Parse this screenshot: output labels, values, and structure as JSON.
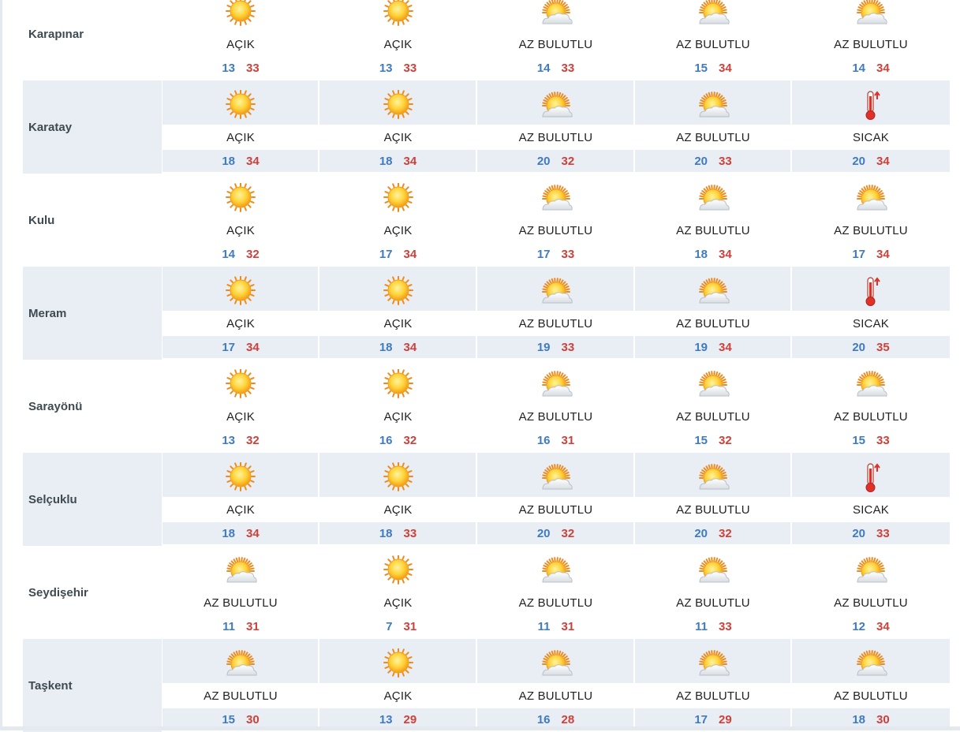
{
  "icons": {
    "sunny": "sun-icon",
    "partly": "sun-cloud-icon",
    "hot": "thermometer-icon"
  },
  "colors": {
    "min": "#3f7bbf",
    "max": "#d0403a",
    "shade": "#e8eef3"
  },
  "rows": [
    {
      "name": "Karapınar",
      "days": [
        {
          "cond": "AÇIK",
          "icon": "sunny",
          "min": "13",
          "max": "33"
        },
        {
          "cond": "AÇIK",
          "icon": "sunny",
          "min": "13",
          "max": "33"
        },
        {
          "cond": "AZ BULUTLU",
          "icon": "partly",
          "min": "14",
          "max": "33"
        },
        {
          "cond": "AZ BULUTLU",
          "icon": "partly",
          "min": "15",
          "max": "34"
        },
        {
          "cond": "AZ BULUTLU",
          "icon": "partly",
          "min": "14",
          "max": "34"
        }
      ]
    },
    {
      "name": "Karatay",
      "days": [
        {
          "cond": "AÇIK",
          "icon": "sunny",
          "min": "18",
          "max": "34"
        },
        {
          "cond": "AÇIK",
          "icon": "sunny",
          "min": "18",
          "max": "34"
        },
        {
          "cond": "AZ BULUTLU",
          "icon": "partly",
          "min": "20",
          "max": "32"
        },
        {
          "cond": "AZ BULUTLU",
          "icon": "partly",
          "min": "20",
          "max": "33"
        },
        {
          "cond": "SICAK",
          "icon": "hot",
          "min": "20",
          "max": "34"
        }
      ]
    },
    {
      "name": "Kulu",
      "days": [
        {
          "cond": "AÇIK",
          "icon": "sunny",
          "min": "14",
          "max": "32"
        },
        {
          "cond": "AÇIK",
          "icon": "sunny",
          "min": "17",
          "max": "34"
        },
        {
          "cond": "AZ BULUTLU",
          "icon": "partly",
          "min": "17",
          "max": "33"
        },
        {
          "cond": "AZ BULUTLU",
          "icon": "partly",
          "min": "18",
          "max": "34"
        },
        {
          "cond": "AZ BULUTLU",
          "icon": "partly",
          "min": "17",
          "max": "34"
        }
      ]
    },
    {
      "name": "Meram",
      "days": [
        {
          "cond": "AÇIK",
          "icon": "sunny",
          "min": "17",
          "max": "34"
        },
        {
          "cond": "AÇIK",
          "icon": "sunny",
          "min": "18",
          "max": "34"
        },
        {
          "cond": "AZ BULUTLU",
          "icon": "partly",
          "min": "19",
          "max": "33"
        },
        {
          "cond": "AZ BULUTLU",
          "icon": "partly",
          "min": "19",
          "max": "34"
        },
        {
          "cond": "SICAK",
          "icon": "hot",
          "min": "20",
          "max": "35"
        }
      ]
    },
    {
      "name": "Sarayönü",
      "days": [
        {
          "cond": "AÇIK",
          "icon": "sunny",
          "min": "13",
          "max": "32"
        },
        {
          "cond": "AÇIK",
          "icon": "sunny",
          "min": "16",
          "max": "32"
        },
        {
          "cond": "AZ BULUTLU",
          "icon": "partly",
          "min": "16",
          "max": "31"
        },
        {
          "cond": "AZ BULUTLU",
          "icon": "partly",
          "min": "15",
          "max": "32"
        },
        {
          "cond": "AZ BULUTLU",
          "icon": "partly",
          "min": "15",
          "max": "33"
        }
      ]
    },
    {
      "name": "Selçuklu",
      "days": [
        {
          "cond": "AÇIK",
          "icon": "sunny",
          "min": "18",
          "max": "34"
        },
        {
          "cond": "AÇIK",
          "icon": "sunny",
          "min": "18",
          "max": "33"
        },
        {
          "cond": "AZ BULUTLU",
          "icon": "partly",
          "min": "20",
          "max": "32"
        },
        {
          "cond": "AZ BULUTLU",
          "icon": "partly",
          "min": "20",
          "max": "32"
        },
        {
          "cond": "SICAK",
          "icon": "hot",
          "min": "20",
          "max": "33"
        }
      ]
    },
    {
      "name": "Seydişehir",
      "days": [
        {
          "cond": "AZ BULUTLU",
          "icon": "partly",
          "min": "11",
          "max": "31"
        },
        {
          "cond": "AÇIK",
          "icon": "sunny",
          "min": "7",
          "max": "31"
        },
        {
          "cond": "AZ BULUTLU",
          "icon": "partly",
          "min": "11",
          "max": "31"
        },
        {
          "cond": "AZ BULUTLU",
          "icon": "partly",
          "min": "11",
          "max": "33"
        },
        {
          "cond": "AZ BULUTLU",
          "icon": "partly",
          "min": "12",
          "max": "34"
        }
      ]
    },
    {
      "name": "Taşkent",
      "days": [
        {
          "cond": "AZ BULUTLU",
          "icon": "partly",
          "min": "15",
          "max": "30"
        },
        {
          "cond": "AÇIK",
          "icon": "sunny",
          "min": "13",
          "max": "29"
        },
        {
          "cond": "AZ BULUTLU",
          "icon": "partly",
          "min": "16",
          "max": "28"
        },
        {
          "cond": "AZ BULUTLU",
          "icon": "partly",
          "min": "17",
          "max": "29"
        },
        {
          "cond": "AZ BULUTLU",
          "icon": "partly",
          "min": "18",
          "max": "30"
        }
      ]
    }
  ]
}
